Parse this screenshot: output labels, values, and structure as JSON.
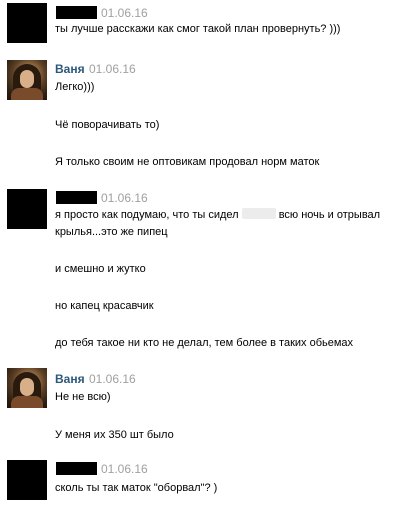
{
  "messages": [
    {
      "author": "",
      "date": "01.06.16",
      "lines": [
        "ты лучше расскажи как смог такой план провернуть? )))"
      ]
    },
    {
      "author": "Ваня",
      "date": "01.06.16",
      "lines": [
        "Легко)))",
        "Чё поворачивать то)",
        "Я только своим не оптовикам продовал норм маток"
      ]
    },
    {
      "author": "",
      "date": "01.06.16",
      "line1_before": "я просто как подумаю, что ты сидел",
      "line1_after": "всю ночь и отрывал",
      "lines": [
        "крылья...это же пипец",
        "и смешно и жутко",
        "но капец красавчик",
        "до тебя такое ни кто не делал, тем более в таких обьемах"
      ]
    },
    {
      "author": "Ваня",
      "date": "01.06.16",
      "lines": [
        "Не не всю)",
        "У меня их 350 шт было"
      ]
    },
    {
      "author": "",
      "date": "01.06.16",
      "lines": [
        "сколь ты так маток \"оборвал\"? )"
      ]
    }
  ]
}
